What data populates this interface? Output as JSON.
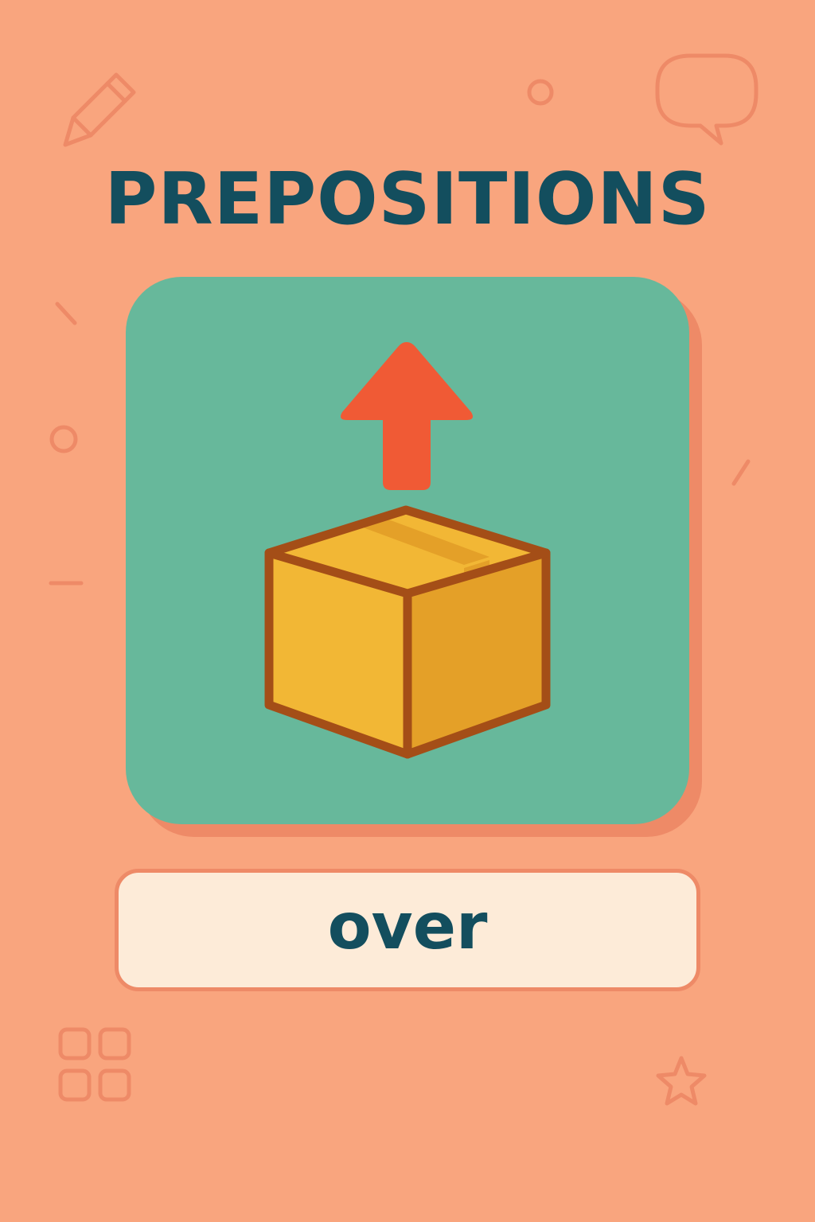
{
  "title": "PREPOSITIONS",
  "word": "over",
  "illustration": {
    "arrow": "up-arrow-icon",
    "object": "cardboard-box-icon"
  },
  "decorations": [
    "pencil-icon",
    "speech-bubble-icon",
    "circle-icon",
    "grid-icon",
    "star-icon"
  ],
  "colors": {
    "background": "#f9a57e",
    "decoration": "#ee8a67",
    "title": "#134e5e",
    "card": "#67b89b",
    "arrow": "#f05a35",
    "box_light": "#f2b735",
    "box_dark": "#e4a028",
    "box_outline": "#a44e17",
    "label_bg": "#fdebd8",
    "label_text": "#134e5e"
  }
}
